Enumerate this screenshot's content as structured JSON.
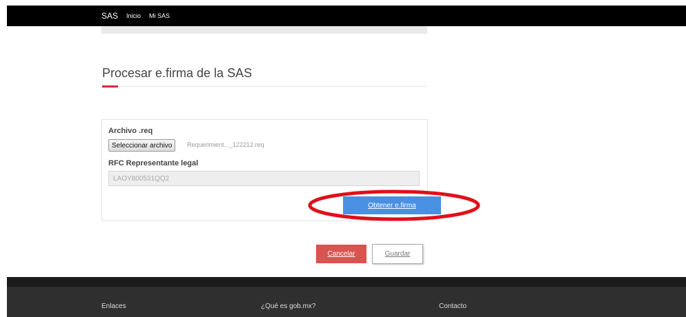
{
  "header": {
    "brand": "SAS",
    "nav": [
      "Inicio",
      "Mi SAS"
    ]
  },
  "page": {
    "title": "Procesar e.firma de la SAS"
  },
  "form": {
    "file_label": "Archivo .req",
    "file_button": "Seleccionar archivo",
    "file_name": "Requerimient..._122212.req",
    "rfc_label": "RFC Representante legal",
    "rfc_value": "LAOY800531QQ2",
    "obtain_button": "Obtener e.firma"
  },
  "actions": {
    "cancel": "Cancelar",
    "save": "Guardar"
  },
  "footer": {
    "links": "Enlaces",
    "about": "¿Qué es gob.mx?",
    "contact": "Contacto"
  },
  "colors": {
    "accent_red": "#d3283a",
    "primary_blue": "#4a90e2",
    "cancel_red": "#d9534f",
    "annotation_red": "#e0101a"
  }
}
